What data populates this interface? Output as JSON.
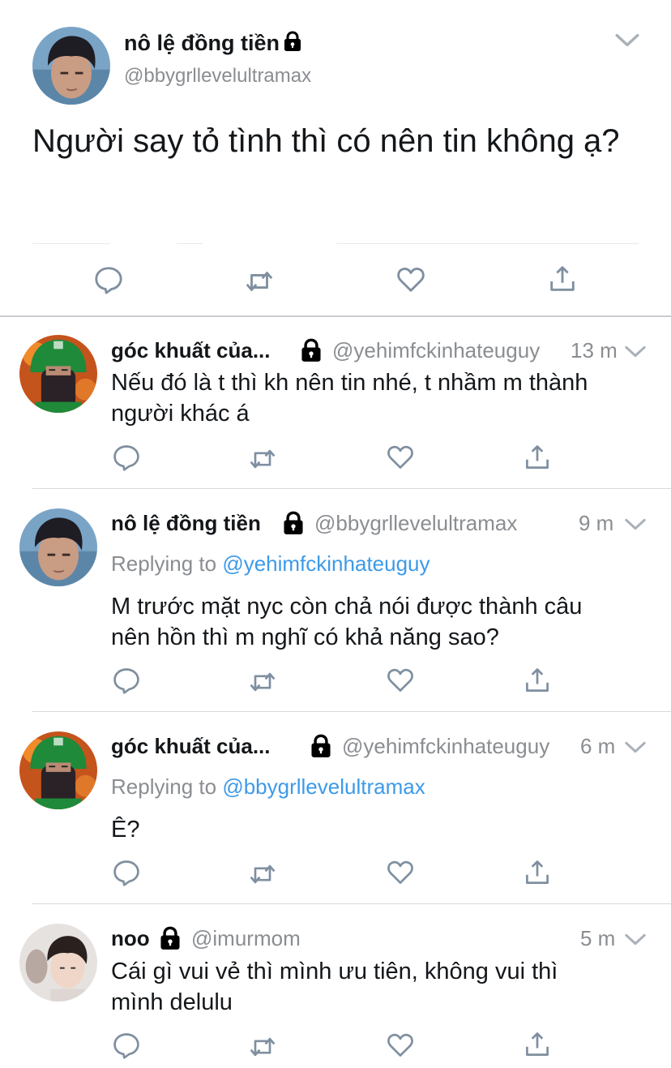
{
  "main_tweet": {
    "author_name": "nô lệ đồng tiền",
    "handle": "@bbygrllevelultramax",
    "text": "Người say tỏ tình thì có nên tin không ạ?",
    "menu_icon": "chevron-down-icon",
    "actions": [
      "reply-icon",
      "retweet-icon",
      "like-icon",
      "share-icon"
    ]
  },
  "replies": [
    {
      "author_name": "góc khuất của...",
      "handle": "@yehimfckinhateuguy",
      "time": "13 m",
      "replying_prefix": "",
      "replying_to": "",
      "text_lines": [
        "Nếu đó là t thì kh nên tin nhé, t nhầm m thành",
        "người khác á"
      ]
    },
    {
      "author_name": "nô lệ đồng tiền",
      "handle": "@bbygrllevelultramax",
      "time": "9 m",
      "replying_prefix": "Replying to ",
      "replying_to": "@yehimfckinhateuguy",
      "text_lines": [
        "M trước mặt nyc còn chả nói được thành câu",
        "nên hồn thì m nghĩ có khả năng sao?"
      ]
    },
    {
      "author_name": "góc khuất của...",
      "handle": "@yehimfckinhateuguy",
      "time": "6 m",
      "replying_prefix": "Replying to ",
      "replying_to": "@bbygrllevelultramax",
      "text_lines": [
        "Ê?"
      ]
    },
    {
      "author_name": "noo",
      "handle": "@imurmom",
      "time": "5 m",
      "replying_prefix": "",
      "replying_to": "",
      "text_lines": [
        "Cái gì vui vẻ thì mình ưu tiên, không vui thì",
        "mình delulu"
      ]
    }
  ],
  "colors": {
    "text": "#14171a",
    "secondary": "#8a8d91",
    "link": "#3d9ae8",
    "icon": "#7f8fa0",
    "divider": "#d8dadd"
  }
}
